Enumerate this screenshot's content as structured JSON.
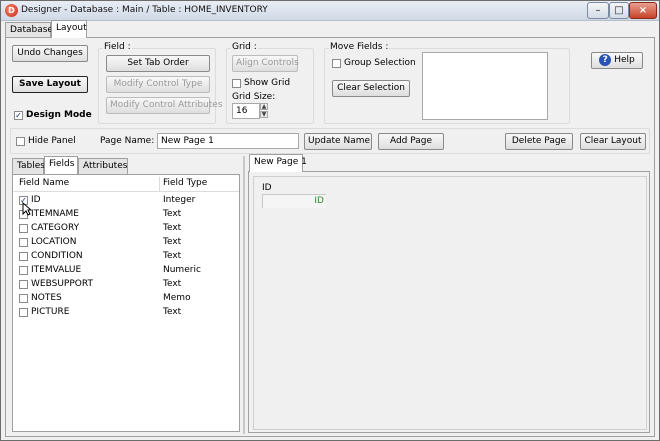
{
  "window": {
    "title": "Designer - Database : Main / Table : HOME_INVENTORY",
    "app_icon": "app-logo-icon",
    "minimize_glyph": "–",
    "maximize_glyph": "□",
    "close_glyph": "×"
  },
  "main_tabs": [
    {
      "label": "Database"
    },
    {
      "label": "Layout"
    }
  ],
  "toolbar": {
    "undo_label": "Undo Changes",
    "save_label": "Save Layout",
    "design_mode_label": "Design Mode",
    "design_mode_checked": "✓",
    "field_group_title": "Field :",
    "set_tab_order_label": "Set Tab Order",
    "modify_control_type_label": "Modify Control Type",
    "modify_control_attributes_label": "Modify Control Attributes",
    "grid_group_title": "Grid :",
    "align_controls_label": "Align Controls",
    "show_grid_label": "Show Grid",
    "grid_size_label": "Grid Size:",
    "grid_size_value": "16",
    "move_fields_title": "Move Fields :",
    "group_selection_label": "Group Selection",
    "clear_selection_label": "Clear Selection",
    "help_label": "Help",
    "help_icon": "help-icon"
  },
  "page_bar": {
    "hide_panel_label": "Hide Panel",
    "page_name_label": "Page Name:",
    "page_name_value": "New Page 1",
    "update_name_label": "Update Name",
    "add_page_label": "Add Page",
    "delete_page_label": "Delete Page",
    "clear_layout_label": "Clear Layout"
  },
  "side_tabs": [
    {
      "label": "Tables"
    },
    {
      "label": "Fields"
    },
    {
      "label": "Attributes"
    }
  ],
  "fields_table": {
    "headers": [
      "Field Name",
      "Field Type"
    ],
    "rows": [
      {
        "name": "ID",
        "type": "Integer",
        "checked": "✓"
      },
      {
        "name": "ITEMNAME",
        "type": "Text",
        "checked": ""
      },
      {
        "name": "CATEGORY",
        "type": "Text",
        "checked": ""
      },
      {
        "name": "LOCATION",
        "type": "Text",
        "checked": ""
      },
      {
        "name": "CONDITION",
        "type": "Text",
        "checked": ""
      },
      {
        "name": "ITEMVALUE",
        "type": "Numeric",
        "checked": ""
      },
      {
        "name": "WEBSUPPORT",
        "type": "Text",
        "checked": ""
      },
      {
        "name": "NOTES",
        "type": "Memo",
        "checked": ""
      },
      {
        "name": "PICTURE",
        "type": "Text",
        "checked": ""
      }
    ]
  },
  "design_area": {
    "page_tab": "New Page 1",
    "field_label": "ID",
    "field_value": "ID",
    "field_value_color": "#2c8a2c"
  }
}
